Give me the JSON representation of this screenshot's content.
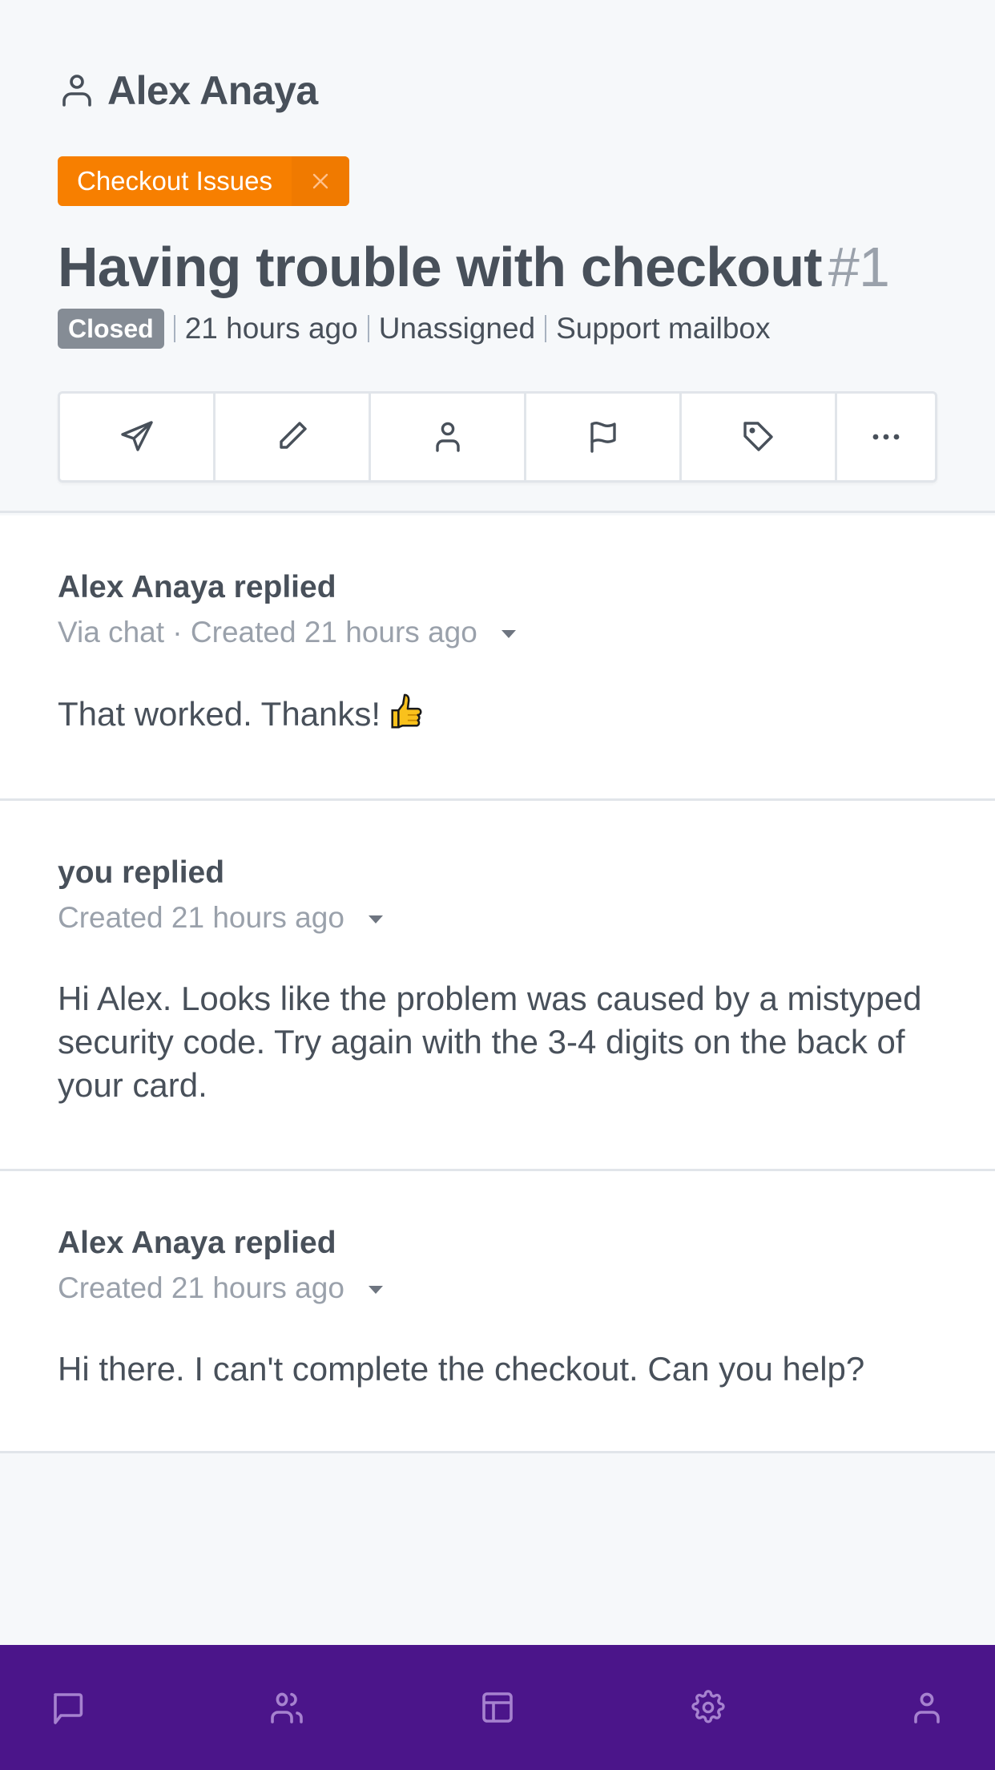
{
  "header": {
    "customer_name": "Alex Anaya",
    "customer_icon": "user-icon",
    "tag": {
      "label": "Checkout Issues",
      "remove_icon": "close-icon",
      "color": "#f77f00"
    },
    "title": "Having trouble with checkout",
    "ticket_number": "#1",
    "status": "Closed",
    "status_color": "#858c95",
    "time": "21 hours ago",
    "assignee": "Unassigned",
    "mailbox": "Support mailbox"
  },
  "toolbar": {
    "buttons": [
      {
        "name": "reply",
        "icon": "send-icon"
      },
      {
        "name": "note",
        "icon": "pencil-icon"
      },
      {
        "name": "assign",
        "icon": "user-icon"
      },
      {
        "name": "flag",
        "icon": "flag-icon"
      },
      {
        "name": "tag",
        "icon": "tag-icon"
      },
      {
        "name": "more",
        "icon": "more-horizontal-icon"
      }
    ]
  },
  "thread": [
    {
      "author": "Alex Anaya replied",
      "meta": "Via chat · Created 21 hours ago",
      "body": "That worked. Thanks!",
      "emoji": "thumbs-up"
    },
    {
      "author": "you replied",
      "meta": "Created 21 hours ago",
      "body": "Hi Alex. Looks like the problem was caused by a mistyped security code. Try again with the 3-4 digits on the back of your card."
    },
    {
      "author": "Alex Anaya replied",
      "meta": "Created 21 hours ago",
      "body": "Hi there. I can't complete the checkout. Can you help?"
    }
  ],
  "bottom_nav": {
    "background": "#4b158a",
    "icon_color": "#a682cf",
    "items": [
      {
        "name": "conversations",
        "icon": "chat-icon"
      },
      {
        "name": "customers",
        "icon": "users-icon"
      },
      {
        "name": "dashboard",
        "icon": "layout-icon"
      },
      {
        "name": "settings",
        "icon": "gear-icon"
      },
      {
        "name": "profile",
        "icon": "user-icon"
      }
    ]
  }
}
